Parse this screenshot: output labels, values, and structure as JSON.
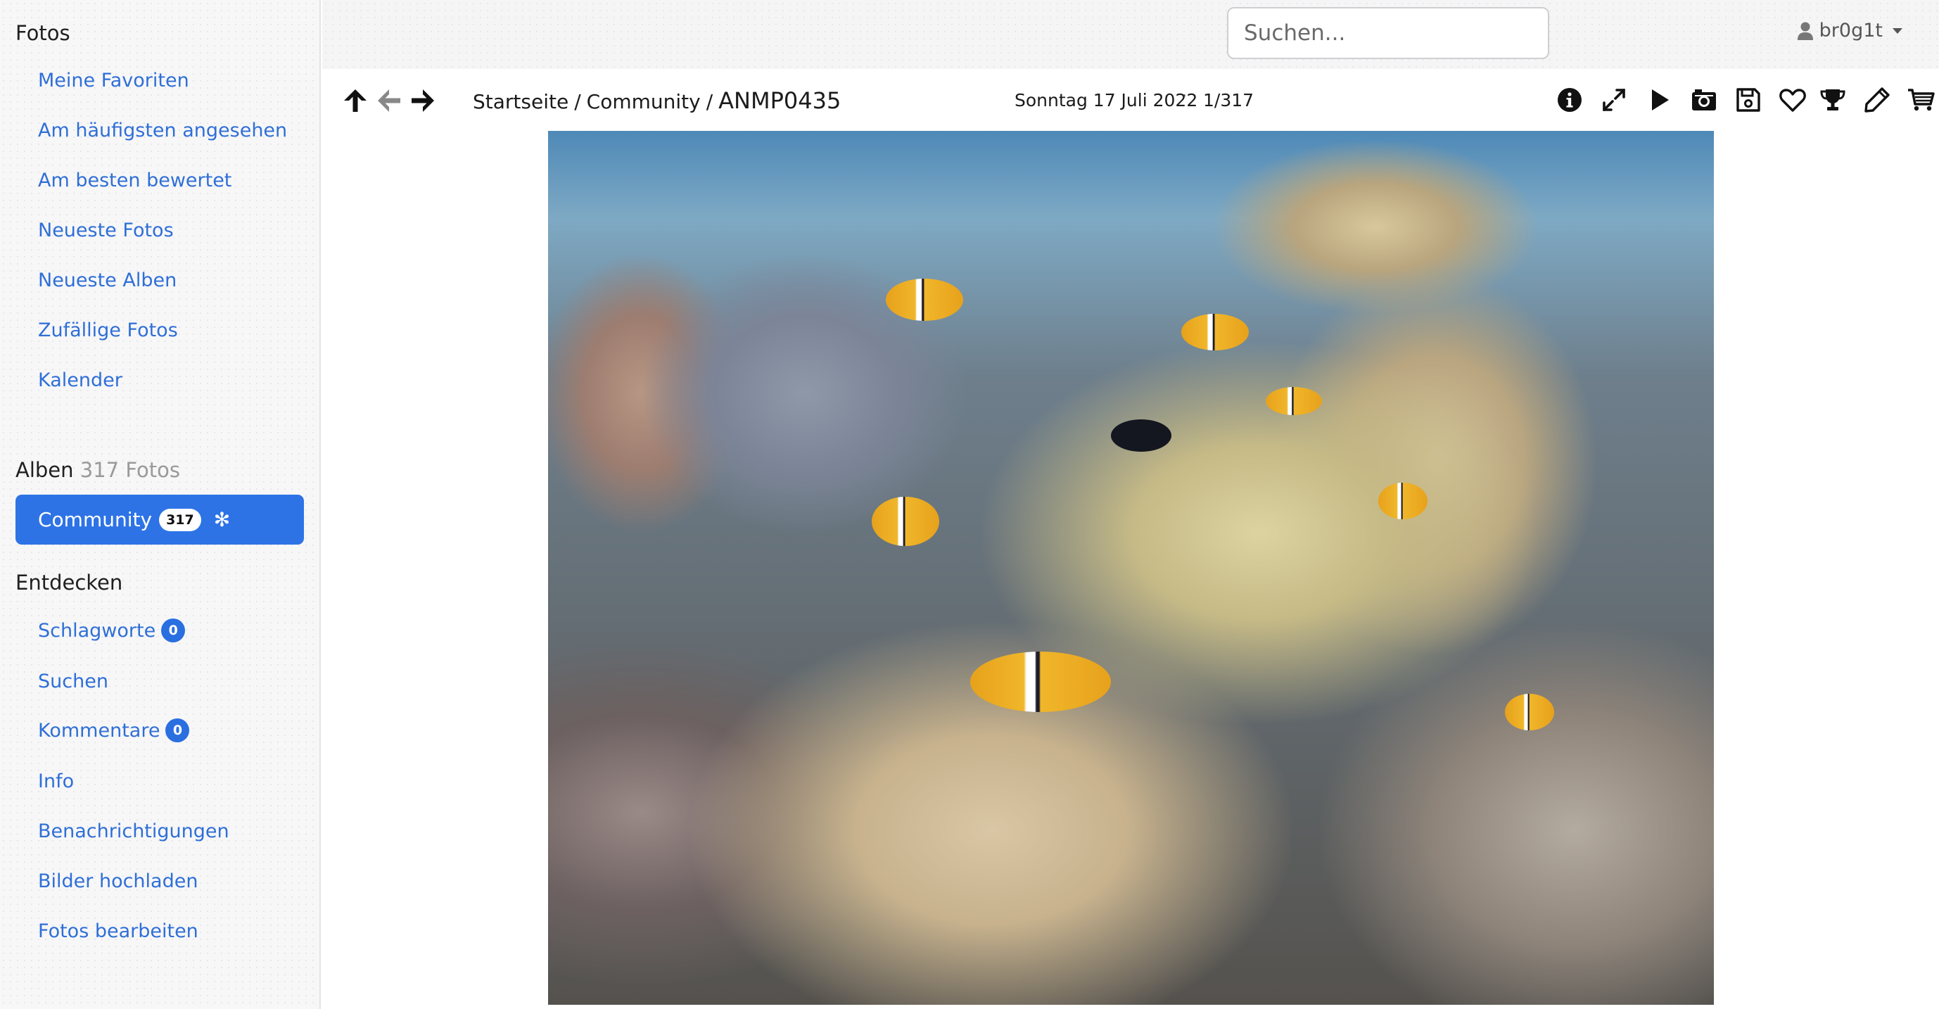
{
  "sidebar": {
    "fotos_heading": "Fotos",
    "fotos_links": [
      {
        "label": "Meine Favoriten"
      },
      {
        "label": "Am häufigsten angesehen"
      },
      {
        "label": "Am besten bewertet"
      },
      {
        "label": "Neueste Fotos"
      },
      {
        "label": "Neueste Alben"
      },
      {
        "label": "Zufällige Fotos"
      },
      {
        "label": "Kalender"
      }
    ],
    "albums_heading": "Alben",
    "albums_count": "317 Fotos",
    "active_album": {
      "label": "Community",
      "count": "317",
      "spinner": "✻"
    },
    "discover_heading": "Entdecken",
    "discover_links": [
      {
        "label": "Schlagworte",
        "badge": "0"
      },
      {
        "label": "Suchen"
      },
      {
        "label": "Kommentare",
        "badge": "0"
      },
      {
        "label": "Info"
      },
      {
        "label": "Benachrichtigungen"
      },
      {
        "label": "Bilder hochladen"
      },
      {
        "label": "Fotos bearbeiten"
      }
    ]
  },
  "header": {
    "search_placeholder": "Suchen...",
    "username": "br0g1t"
  },
  "toolbar": {
    "nav_icons": [
      "arrow-up-icon",
      "arrow-left-icon",
      "arrow-right-icon"
    ],
    "breadcrumb": {
      "home": "Startseite",
      "separator": "/",
      "album": "Community",
      "current": "ANMP0435"
    },
    "date": "Sonntag 17 Juli 2022",
    "separator_dot": "·",
    "counter": "1/317",
    "tool_icons": [
      "info-icon",
      "expand-icon",
      "play-icon",
      "camera-icon",
      "save-icon",
      "heart-icon",
      "trophy-icon",
      "pencil-icon",
      "cart-icon"
    ]
  },
  "photo": {
    "alt": "ANMP0435"
  },
  "colors": {
    "link": "#2f6fd6",
    "active_album_bg": "#2d73e6",
    "badge_bg": "#2a6fe0",
    "sidebar_bg": "#f7f7f8"
  }
}
